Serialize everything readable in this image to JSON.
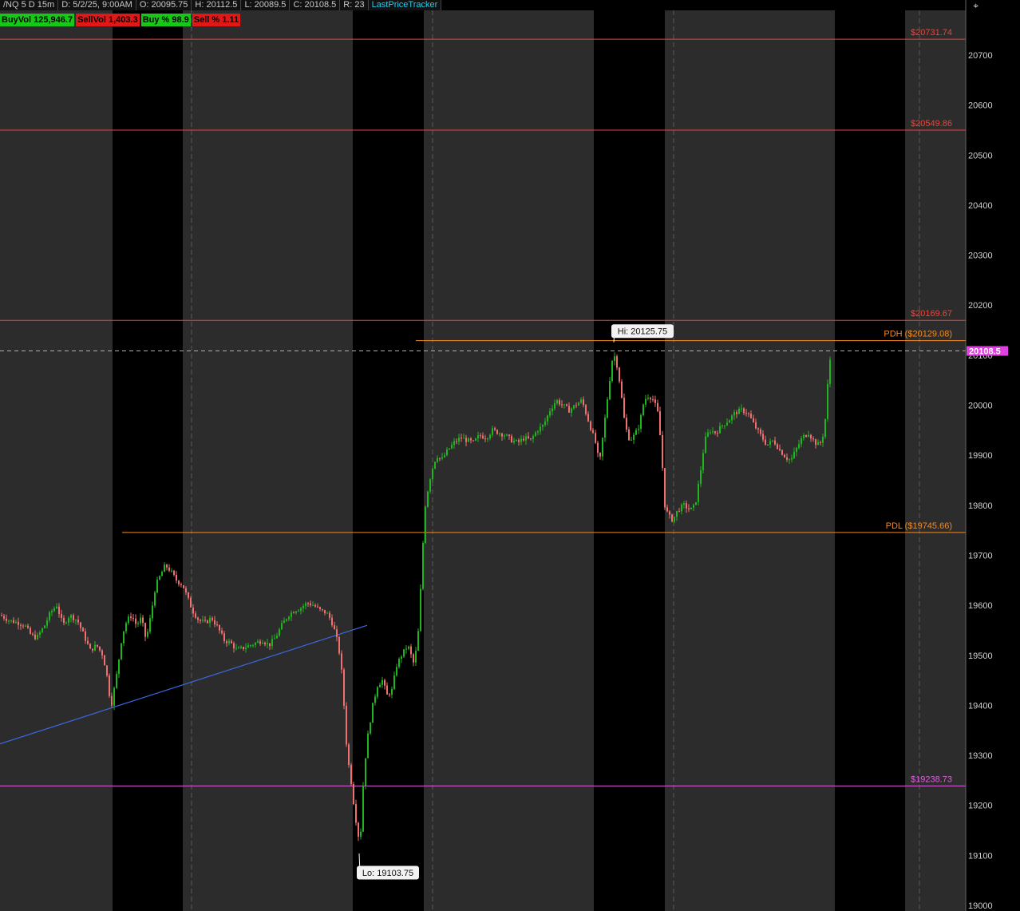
{
  "header": {
    "symbol": "/NQ 5 D 15m",
    "date": "D: 5/2/25, 9:00AM",
    "open": "O: 20095.75",
    "high": "H: 20112.5",
    "low": "L: 20089.5",
    "close": "C: 20108.5",
    "range": "R: 23",
    "study": "LastPriceTracker"
  },
  "badges": {
    "buyvol": "BuyVol  125,946.7",
    "sellvol": "SellVol  1,403.3",
    "buypct": "Buy %  98.9",
    "sellpct": "Sell %  1.11"
  },
  "corner_icon": "crosshair-settings-icon",
  "colors": {
    "background": "#000000",
    "session_shade": "#2c2c2c",
    "up": "#1fb51f",
    "down": "#f07070",
    "level_red": "#e8463c",
    "level_orange": "#f08a24",
    "level_magenta": "#e060e0",
    "last_price": "#40e0e8",
    "trendline": "#3a68e0",
    "price_tag": "#e040e0"
  },
  "chart_data": {
    "type": "candlestick",
    "title": "",
    "xlabel": "",
    "ylabel": "",
    "ylim": [
      19000,
      20950
    ],
    "y_ticks": [
      19000,
      19100,
      19200,
      19300,
      19400,
      19500,
      19600,
      19700,
      19800,
      19900,
      20000,
      20100,
      20200,
      20300,
      20400,
      20500,
      20600,
      20700
    ],
    "y_tick_labels": [
      "19000",
      "19100",
      "19200",
      "19300",
      "19400",
      "19500",
      "19600",
      "19700",
      "19800",
      "19900",
      "20000",
      "20100",
      "20200",
      "20300",
      "20400",
      "20500",
      "20600",
      "20700"
    ],
    "grid": false,
    "levels": [
      {
        "label": "$20731.74",
        "value": 20731.74,
        "color": "level_red"
      },
      {
        "label": "$20549.86",
        "value": 20549.86,
        "color": "level_red"
      },
      {
        "label": "$20169.67",
        "value": 20169.67,
        "color": "level_red"
      },
      {
        "label": "PDH ($20129.08)",
        "value": 20129.08,
        "color": "level_orange"
      },
      {
        "label": "PDL ($19745.66)",
        "value": 19745.66,
        "color": "level_orange"
      },
      {
        "label": "$19238.73",
        "value": 19238.73,
        "color": "level_magenta"
      }
    ],
    "last_price": {
      "label": "20108.5",
      "value": 20108.5
    },
    "annotations": [
      {
        "label": "Hi: 20125.75",
        "value": 20125.75
      },
      {
        "label": "Lo: 19103.75",
        "value": 19103.75
      }
    ],
    "trendline": {
      "from": 19323,
      "to": 19560
    },
    "path": [
      [
        0,
        19580
      ],
      [
        10,
        19570
      ],
      [
        22,
        19565
      ],
      [
        30,
        19560
      ],
      [
        38,
        19540
      ],
      [
        45,
        19535
      ],
      [
        55,
        19560
      ],
      [
        62,
        19585
      ],
      [
        70,
        19600
      ],
      [
        78,
        19560
      ],
      [
        86,
        19580
      ],
      [
        96,
        19570
      ],
      [
        104,
        19540
      ],
      [
        112,
        19510
      ],
      [
        120,
        19520
      ],
      [
        128,
        19500
      ],
      [
        134,
        19450
      ],
      [
        138,
        19395
      ],
      [
        146,
        19470
      ],
      [
        152,
        19540
      ],
      [
        158,
        19570
      ],
      [
        164,
        19580
      ],
      [
        170,
        19560
      ],
      [
        176,
        19575
      ],
      [
        182,
        19530
      ],
      [
        188,
        19580
      ],
      [
        194,
        19640
      ],
      [
        200,
        19660
      ],
      [
        206,
        19680
      ],
      [
        212,
        19670
      ],
      [
        220,
        19650
      ],
      [
        228,
        19640
      ],
      [
        234,
        19615
      ],
      [
        240,
        19590
      ],
      [
        248,
        19570
      ],
      [
        256,
        19565
      ],
      [
        264,
        19575
      ],
      [
        272,
        19555
      ],
      [
        280,
        19530
      ],
      [
        288,
        19525
      ],
      [
        296,
        19510
      ],
      [
        304,
        19515
      ],
      [
        312,
        19520
      ],
      [
        320,
        19525
      ],
      [
        328,
        19530
      ],
      [
        336,
        19520
      ],
      [
        344,
        19535
      ],
      [
        352,
        19560
      ],
      [
        360,
        19580
      ],
      [
        368,
        19590
      ],
      [
        376,
        19595
      ],
      [
        384,
        19605
      ],
      [
        392,
        19600
      ],
      [
        400,
        19590
      ],
      [
        408,
        19585
      ],
      [
        414,
        19570
      ],
      [
        420,
        19540
      ],
      [
        426,
        19490
      ],
      [
        430,
        19400
      ],
      [
        434,
        19300
      ],
      [
        438,
        19260
      ],
      [
        444,
        19180
      ],
      [
        450,
        19120
      ],
      [
        455,
        19270
      ],
      [
        460,
        19340
      ],
      [
        466,
        19400
      ],
      [
        472,
        19440
      ],
      [
        478,
        19450
      ],
      [
        484,
        19420
      ],
      [
        490,
        19430
      ],
      [
        496,
        19480
      ],
      [
        502,
        19500
      ],
      [
        510,
        19520
      ],
      [
        518,
        19480
      ],
      [
        524,
        19560
      ],
      [
        528,
        19700
      ],
      [
        532,
        19800
      ],
      [
        536,
        19840
      ],
      [
        540,
        19870
      ],
      [
        546,
        19900
      ],
      [
        552,
        19890
      ],
      [
        560,
        19910
      ],
      [
        568,
        19925
      ],
      [
        576,
        19935
      ],
      [
        584,
        19930
      ],
      [
        592,
        19925
      ],
      [
        600,
        19940
      ],
      [
        608,
        19935
      ],
      [
        616,
        19950
      ],
      [
        624,
        19945
      ],
      [
        632,
        19940
      ],
      [
        640,
        19930
      ],
      [
        648,
        19925
      ],
      [
        656,
        19935
      ],
      [
        664,
        19930
      ],
      [
        672,
        19950
      ],
      [
        680,
        19960
      ],
      [
        688,
        19990
      ],
      [
        696,
        20010
      ],
      [
        704,
        20000
      ],
      [
        712,
        19990
      ],
      [
        720,
        20000
      ],
      [
        728,
        20010
      ],
      [
        734,
        19980
      ],
      [
        740,
        19950
      ],
      [
        746,
        19920
      ],
      [
        750,
        19880
      ],
      [
        756,
        19960
      ],
      [
        762,
        20040
      ],
      [
        766,
        20090
      ],
      [
        770,
        20100
      ],
      [
        776,
        20040
      ],
      [
        782,
        19960
      ],
      [
        788,
        19930
      ],
      [
        794,
        19940
      ],
      [
        800,
        19960
      ],
      [
        806,
        20010
      ],
      [
        812,
        20020
      ],
      [
        818,
        20010
      ],
      [
        824,
        19980
      ],
      [
        828,
        19900
      ],
      [
        832,
        19800
      ],
      [
        836,
        19780
      ],
      [
        842,
        19770
      ],
      [
        848,
        19790
      ],
      [
        856,
        19800
      ],
      [
        864,
        19790
      ],
      [
        870,
        19800
      ],
      [
        876,
        19860
      ],
      [
        882,
        19930
      ],
      [
        888,
        19950
      ],
      [
        896,
        19945
      ],
      [
        904,
        19960
      ],
      [
        912,
        19970
      ],
      [
        920,
        19985
      ],
      [
        928,
        19990
      ],
      [
        936,
        19985
      ],
      [
        944,
        19960
      ],
      [
        952,
        19940
      ],
      [
        960,
        19920
      ],
      [
        968,
        19930
      ],
      [
        976,
        19910
      ],
      [
        984,
        19895
      ],
      [
        990,
        19890
      ],
      [
        996,
        19910
      ],
      [
        1004,
        19935
      ],
      [
        1012,
        19945
      ],
      [
        1020,
        19925
      ],
      [
        1026,
        19920
      ],
      [
        1032,
        19950
      ],
      [
        1036,
        20040
      ],
      [
        1040,
        20108
      ]
    ]
  }
}
